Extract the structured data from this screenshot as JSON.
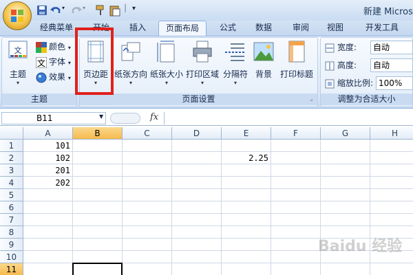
{
  "window": {
    "title": "新建 Micros",
    "quick_access": [
      "save-icon",
      "undo-icon",
      "redo-icon",
      "format-painter-icon",
      "paste-icon",
      "customize-icon"
    ]
  },
  "tabs": [
    {
      "label": "经典菜单",
      "active": false
    },
    {
      "label": "开始",
      "active": false
    },
    {
      "label": "插入",
      "active": false
    },
    {
      "label": "页面布局",
      "active": true
    },
    {
      "label": "公式",
      "active": false
    },
    {
      "label": "数据",
      "active": false
    },
    {
      "label": "审阅",
      "active": false
    },
    {
      "label": "视图",
      "active": false
    },
    {
      "label": "开发工具",
      "active": false
    }
  ],
  "ribbon": {
    "theme_group": {
      "label": "主题",
      "theme_button": "主题",
      "colors": "颜色",
      "fonts": "字体",
      "effects": "效果"
    },
    "page_setup_group": {
      "label": "页面设置",
      "buttons": [
        "页边距",
        "纸张方向",
        "纸张大小",
        "打印区域",
        "分隔符",
        "背景",
        "打印标题"
      ]
    },
    "scale_group": {
      "label": "调整为合适大小",
      "width_label": "宽度:",
      "width_value": "自动",
      "height_label": "高度:",
      "height_value": "自动",
      "scale_label": "缩放比例:",
      "scale_value": "100%"
    }
  },
  "formula_bar": {
    "name_box": "B11",
    "fx": "fx"
  },
  "sheet": {
    "columns": [
      "A",
      "B",
      "C",
      "D",
      "E",
      "F",
      "G",
      "H"
    ],
    "selected_column": "B",
    "rows": [
      "1",
      "2",
      "3",
      "4",
      "5",
      "6",
      "7",
      "8",
      "9",
      "10",
      "11"
    ],
    "selected_row": "11",
    "cells": [
      {
        "ref": "A1",
        "value": "101"
      },
      {
        "ref": "A2",
        "value": "102"
      },
      {
        "ref": "E2",
        "value": "2.25"
      },
      {
        "ref": "A3",
        "value": "201"
      },
      {
        "ref": "A4",
        "value": "202"
      }
    ],
    "selected_cell": "B11"
  },
  "watermark": "Baidu 经验",
  "colors": {
    "highlight": "#e0201b",
    "selected_header": "#f7b94e",
    "ribbon_blue": "#dbe8f7"
  }
}
